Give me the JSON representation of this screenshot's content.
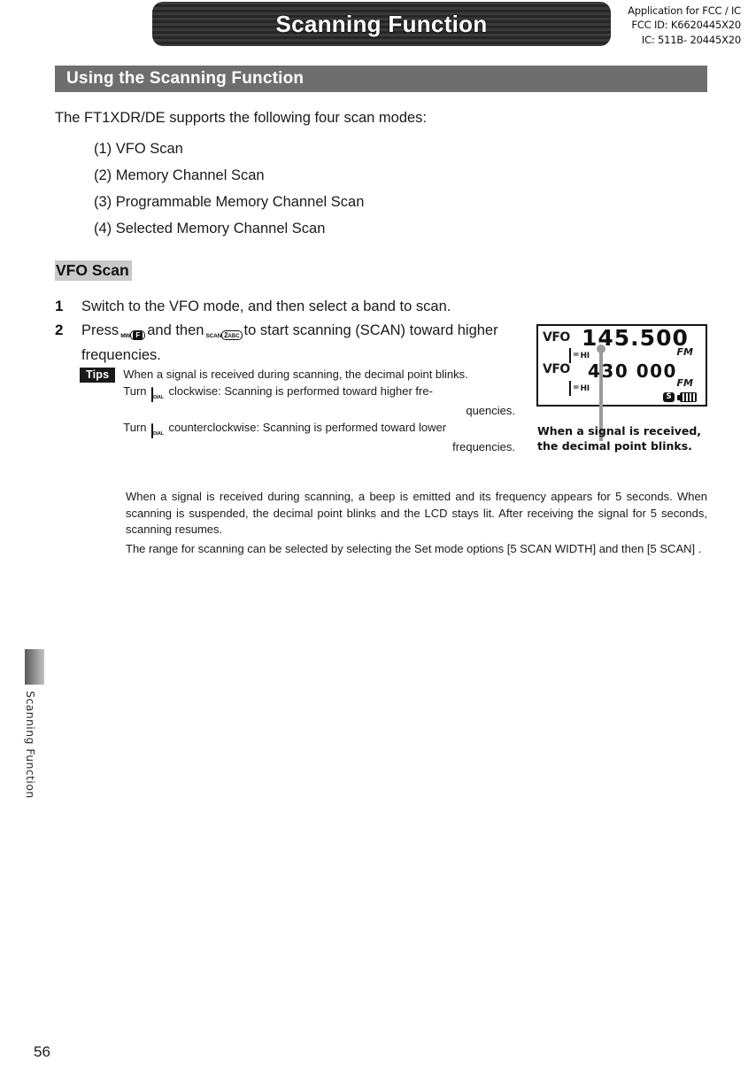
{
  "banner": {
    "title": "Scanning Function"
  },
  "fcc": {
    "line1": "Application for FCC /  IC",
    "line2": "FCC ID: K6620445X20",
    "line3": "IC: 511B- 20445X20"
  },
  "section": {
    "title": "Using the Scanning Function"
  },
  "intro": "The FT1XDR/DE supports the following four scan modes:",
  "modes": [
    "(1) VFO Scan",
    "(2) Memory Channel Scan",
    "(3) Programmable Memory Channel Scan",
    "(4) Selected Memory Channel Scan"
  ],
  "subheading": "VFO Scan",
  "steps": [
    {
      "num": "1",
      "text": "Switch to the VFO mode, and then select a band to scan."
    },
    {
      "num": "2",
      "text_before": "Press",
      "text_mid": "and then",
      "text_after": "to start scanning (SCAN) toward higher frequencies."
    }
  ],
  "keys": {
    "f_key_cap": "MW",
    "f_key_label": "F",
    "scan_key_cap": "SCAN",
    "scan_key_digit": "2",
    "scan_key_letters": "ABC",
    "dial_label": "DIAL"
  },
  "tips": {
    "badge": "Tips",
    "line1": "When a signal is received during scanning, the decimal point blinks.",
    "turn_cw_before": "Turn",
    "turn_cw_after": "clockwise: Scanning  is  performed  toward  higher  fre-",
    "turn_cw_cont": "quencies.",
    "turn_ccw_before": "Turn",
    "turn_ccw_after": "counterclockwise: Scanning is performed toward lower",
    "turn_ccw_cont": "frequencies."
  },
  "paragraphs": {
    "p1": "When a signal is received during scanning, a beep is emitted and its frequency appears for 5 seconds. When scanning is suspended, the decimal point blinks and the LCD stays lit. After receiving the signal for 5 seconds, scanning resumes.",
    "p2": "The range for scanning can be selected by selecting the Set mode options [5 SCAN WIDTH] and then [5 SCAN] ."
  },
  "lcd": {
    "vfo_label_1": "VFO",
    "vfo_label_2": "VFO",
    "freq_1": "145.500",
    "freq_2": "430  000",
    "mode_1": "FM",
    "mode_2": "FM",
    "hi_eq_1": "=",
    "hi_text_1": "HI",
    "hi_eq_2": "=",
    "hi_text_2": "HI",
    "s_badge": "S",
    "caption_line1": "When a signal is received,",
    "caption_line2": "the decimal point blinks."
  },
  "sidebar": {
    "vertical_label": "Scanning Function"
  },
  "page_number": "56"
}
